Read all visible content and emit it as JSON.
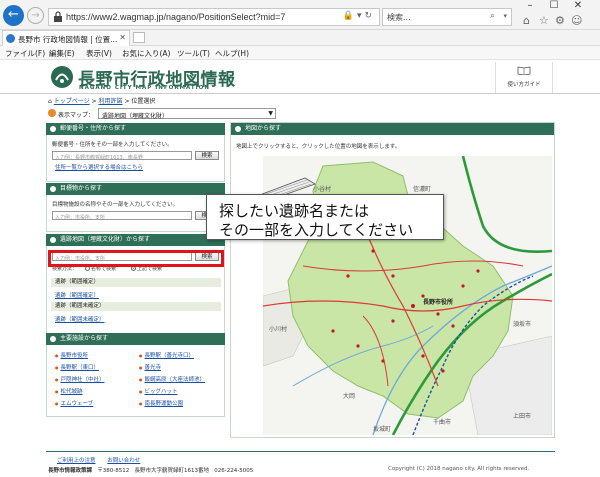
{
  "browser": {
    "url": "https://www2.wagmap.jp/nagano/PositionSelect?mid=7",
    "search_placeholder": "検索...",
    "tab_title": "長野市 行政地図情報 | 位置...",
    "menu": [
      "ファイル(F)",
      "編集(E)",
      "表示(V)",
      "お気に入り(A)",
      "ツール(T)",
      "ヘルプ(H)"
    ]
  },
  "header": {
    "title": "長野市行政地図情報",
    "subtitle": "NAGANO CITY MAP INFORMATION",
    "guide_label": "使い方ガイド"
  },
  "breadcrumb": {
    "home": "トップページ",
    "terms": "利用許諾",
    "current": "位置選択",
    "sep": ">"
  },
  "maptype": {
    "label": "表示マップ：",
    "value": "遺跡地図（埋蔵文化財）"
  },
  "panel_address": {
    "title": "郵便番号・住所から探す",
    "desc": "郵便番号・住所をその一部を入力してください。",
    "placeholder": "入力例：長野市鶴賀緑町1613、南長野",
    "button": "検索",
    "link": "住所一覧から選択する場合はこちら"
  },
  "panel_landmark": {
    "title": "目標物から探す",
    "desc": "目標物施設の名称やその一部を入力してください。",
    "placeholder": "入力例：市役所、支所",
    "button": "検索"
  },
  "panel_ruins": {
    "title": "遺跡地図（埋蔵文化財）から探す",
    "placeholder": "入力例：市役所、支所",
    "button": "検索",
    "search_type_label": "検索方法：",
    "radio_partial": "名称で検索",
    "radio_exact": "上記で検索",
    "group1": "遺跡（範囲確定）",
    "link1": "遺跡（範囲確定）",
    "group2": "遺跡（範囲未確定）",
    "link2": "遺跡（範囲未確定）"
  },
  "panel_facilities": {
    "title": "主要施設から探す",
    "left": [
      "長野市役所",
      "長野駅（東口）",
      "戸隠神社（中社）",
      "松代城跡",
      "エムウェーブ"
    ],
    "right": [
      "長野駅（善光寺口）",
      "善光寺",
      "飯綱高原（大座法師池）",
      "ビッグハット",
      "南長野運動公園"
    ]
  },
  "map_panel": {
    "title": "地図から探す",
    "desc": "地図上でクリックすると、クリックした位置の地図を表示します。",
    "labels": {
      "obuse": "小谷村",
      "shinano": "信濃町",
      "ogawa": "小川村",
      "city_hall": "長野市役所",
      "suzaka": "須坂市",
      "chikuma": "千曲市",
      "ueda": "上田市",
      "sakaki": "坂城町",
      "omachi": "大岡"
    }
  },
  "callout": {
    "line1": "探したい遺跡名または",
    "line2": "その一部を入力してください"
  },
  "footer": {
    "link_terms": "ご利用上の注意",
    "link_contact": "お問い合わせ",
    "org": "長野市情報政策課",
    "postal": "〒380-8512",
    "address": "長野市大字鶴賀緑町1613番地",
    "phone": "026-224-5005",
    "copyright": "Copyright (C) 2018 nagano city. All rights reserved."
  },
  "colors": {
    "brand_green": "#2f6f57",
    "link_blue": "#1a4fa6",
    "highlight_red": "#e0141b",
    "map_land": "#c9e6a6",
    "map_road": "#d93a3a",
    "map_expressway": "#2d9a3a"
  }
}
